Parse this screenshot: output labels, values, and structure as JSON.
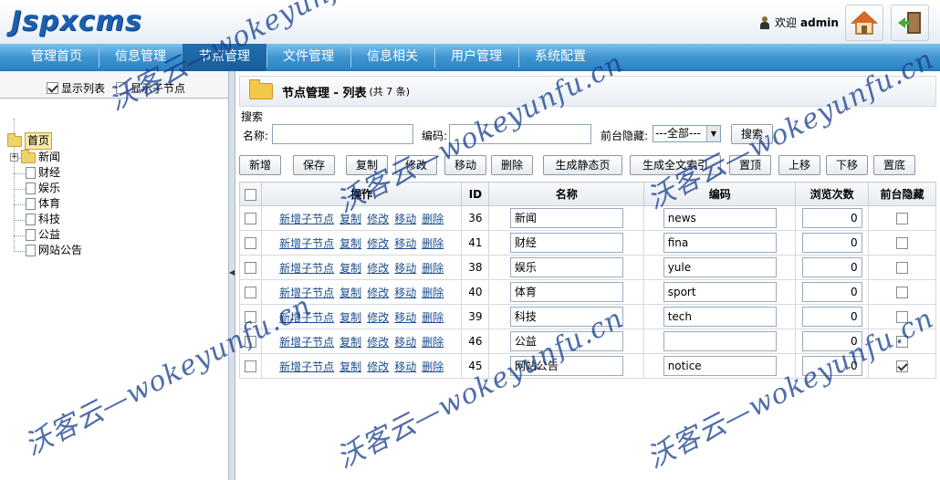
{
  "header": {
    "logo": "Jspxcms",
    "welcome": "欢迎",
    "username": "admin"
  },
  "nav": {
    "items": [
      "管理首页",
      "信息管理",
      "节点管理",
      "文件管理",
      "信息相关",
      "用户管理",
      "系统配置"
    ],
    "active_index": 2
  },
  "left": {
    "show_list_label": "显示列表",
    "show_list_checked": true,
    "show_children_label": "显示子节点",
    "show_children_checked": false,
    "tree": {
      "root": "首页",
      "children": [
        "新闻",
        "财经",
        "娱乐",
        "体育",
        "科技",
        "公益",
        "网站公告"
      ]
    }
  },
  "main": {
    "title": "节点管理 - 列表",
    "count_text": "(共 7 条)",
    "search": {
      "legend": "搜索",
      "name_label": "名称:",
      "name_value": "",
      "code_label": "编码:",
      "code_value": "",
      "hide_label": "前台隐藏:",
      "hide_value": "---全部---",
      "search_button": "搜索"
    },
    "toolbar": {
      "new": "新增",
      "save": "保存",
      "copy": "复制",
      "edit": "修改",
      "move": "移动",
      "delete": "删除",
      "gen_static": "生成静态页",
      "gen_index": "生成全文索引",
      "top": "置顶",
      "up": "上移",
      "down": "下移",
      "bottom": "置底"
    },
    "table": {
      "headers": {
        "ops": "操作",
        "id": "ID",
        "name": "名称",
        "code": "编码",
        "views": "浏览次数",
        "hidden": "前台隐藏"
      },
      "row_ops": {
        "add_child": "新增子节点",
        "copy": "复制",
        "edit": "修改",
        "move": "移动",
        "delete": "删除"
      },
      "rows": [
        {
          "id": "36",
          "name": "新闻",
          "code": "news",
          "views": "0",
          "hidden": false
        },
        {
          "id": "41",
          "name": "财经",
          "code": "fina",
          "views": "0",
          "hidden": false
        },
        {
          "id": "38",
          "name": "娱乐",
          "code": "yule",
          "views": "0",
          "hidden": false
        },
        {
          "id": "40",
          "name": "体育",
          "code": "sport",
          "views": "0",
          "hidden": false
        },
        {
          "id": "39",
          "name": "科技",
          "code": "tech",
          "views": "0",
          "hidden": false
        },
        {
          "id": "46",
          "name": "公益",
          "code": "",
          "views": "0",
          "hidden": false
        },
        {
          "id": "45",
          "name": "网站公告",
          "code": "notice",
          "views": "0",
          "hidden": true
        }
      ]
    }
  },
  "watermark": {
    "text_cn": "沃客云—wokeyunfu.cn"
  },
  "colors": {
    "nav": "#3f96d2",
    "nav_active": "#1b5d98",
    "logo": "#1b5fb0",
    "link": "#1c4d8c"
  }
}
